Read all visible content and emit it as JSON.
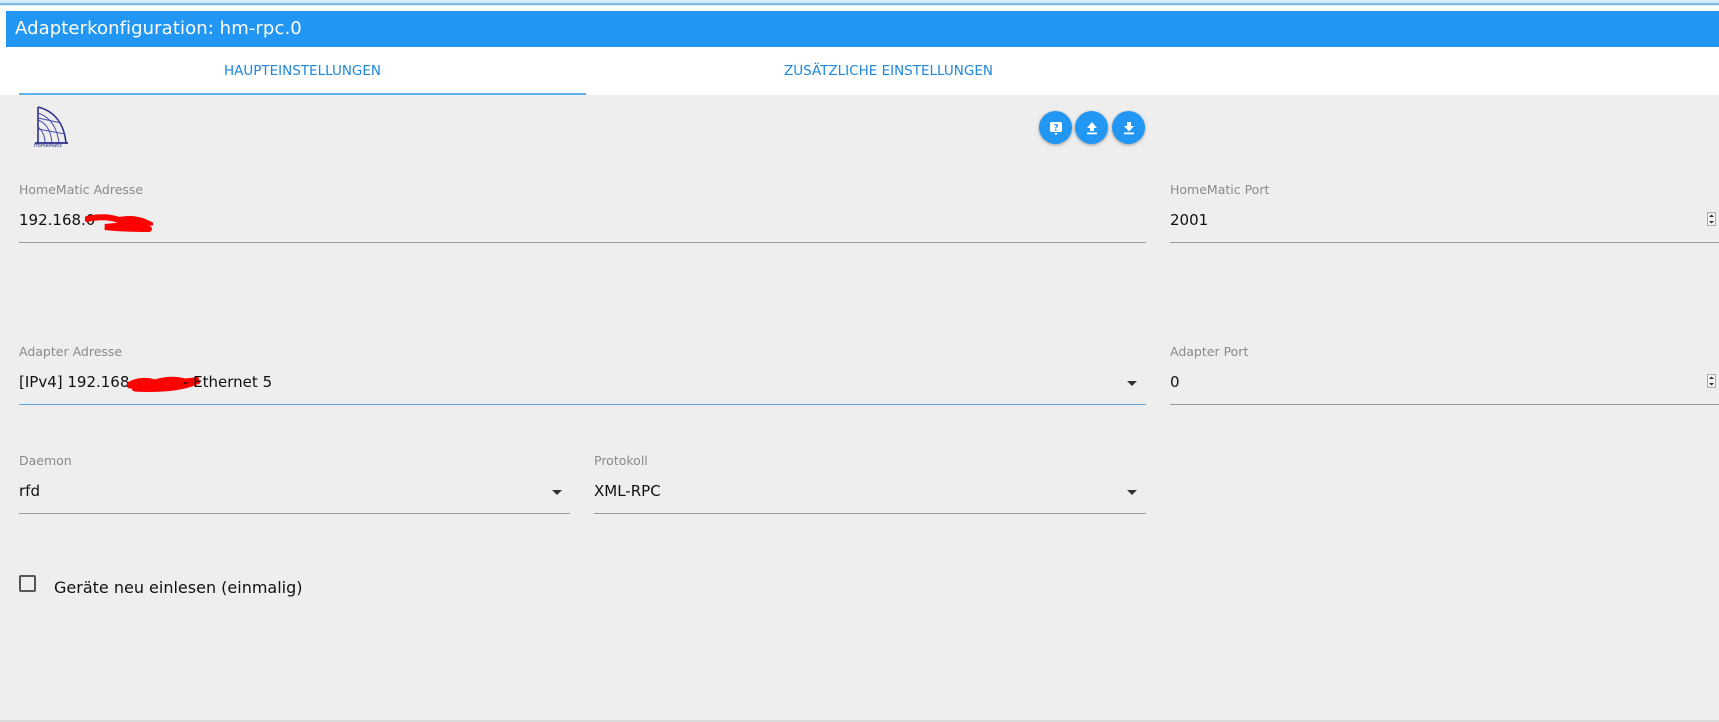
{
  "window": {
    "title": "Adapterkonfiguration: hm-rpc.0"
  },
  "tabs": [
    {
      "label": "HAUPTEINSTELLUNGEN",
      "active": true
    },
    {
      "label": "ZUSÄTZLICHE EINSTELLUNGEN",
      "active": false
    }
  ],
  "logo": {
    "text": "HomeMatic"
  },
  "actions": {
    "help_icon": "help-icon",
    "upload_icon": "upload-icon",
    "download_icon": "download-icon"
  },
  "fields": {
    "homematic_address": {
      "label": "HomeMatic Adresse",
      "value": "192.168.0"
    },
    "homematic_port": {
      "label": "HomeMatic Port",
      "value": "2001"
    },
    "adapter_address": {
      "label": "Adapter Adresse",
      "value_prefix": "[IPv4] 192.168.",
      "value_suffix": "- Ethernet 5"
    },
    "adapter_port": {
      "label": "Adapter Port",
      "value": "0"
    },
    "daemon": {
      "label": "Daemon",
      "value": "rfd"
    },
    "protocol": {
      "label": "Protokoll",
      "value": "XML-RPC"
    }
  },
  "checkbox": {
    "label": "Geräte neu einlesen (einmalig)",
    "checked": false
  },
  "colors": {
    "accent": "#2196f3",
    "background": "#eeeeee",
    "redaction": "#ff0000"
  }
}
